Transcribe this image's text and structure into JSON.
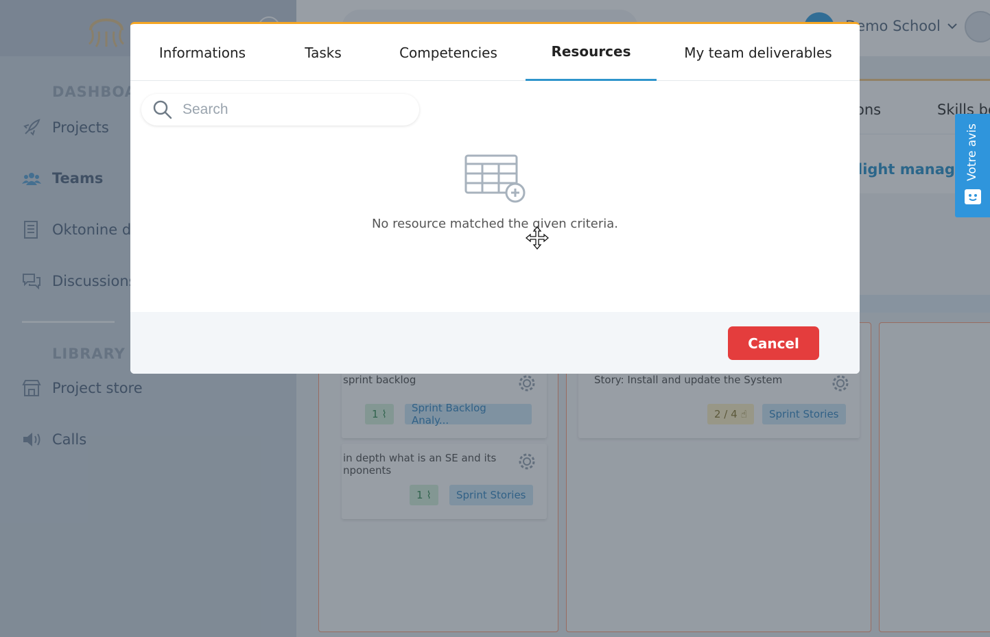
{
  "app": {
    "school_name": "Demo School",
    "sidebar": {
      "dashboard_heading": "DASHBOARD",
      "library_heading": "LIBRARY",
      "items": [
        {
          "label": "Projects",
          "icon": "rocket-icon"
        },
        {
          "label": "Teams",
          "icon": "team-icon",
          "active": true
        },
        {
          "label": "Oktonine drive",
          "icon": "drive-icon"
        },
        {
          "label": "Discussions",
          "icon": "chat-icon"
        },
        {
          "label": "Project store",
          "icon": "store-icon"
        },
        {
          "label": "Calls",
          "icon": "speaker-icon"
        }
      ]
    },
    "content_tabs": {
      "partial_tab": "ons",
      "skills_tab": "Skills bo"
    },
    "banner_text": "light manager",
    "cards": [
      {
        "title": "sprint backlog",
        "count": "1",
        "tag": "Sprint Backlog Analy..."
      },
      {
        "title": "Story: Install and update the System",
        "count": "2 / 4",
        "tag": "Sprint Stories"
      },
      {
        "title": "in depth what is an SE and its\nnponents",
        "count": "1",
        "tag": "Sprint Stories"
      }
    ],
    "feedback_label": "Votre avis",
    "colors": {
      "accent_blue": "#2f95cc",
      "modal_top_border": "#f5a623",
      "cancel_red": "#e43d3d"
    }
  },
  "modal": {
    "tabs": [
      {
        "label": "Informations",
        "active": false
      },
      {
        "label": "Tasks",
        "active": false
      },
      {
        "label": "Competencies",
        "active": false
      },
      {
        "label": "Resources",
        "active": true
      },
      {
        "label": "My team deliverables",
        "active": false
      }
    ],
    "search_placeholder": "Search",
    "search_value": "",
    "empty_message": "No resource matched the given criteria.",
    "cancel_label": "Cancel"
  }
}
